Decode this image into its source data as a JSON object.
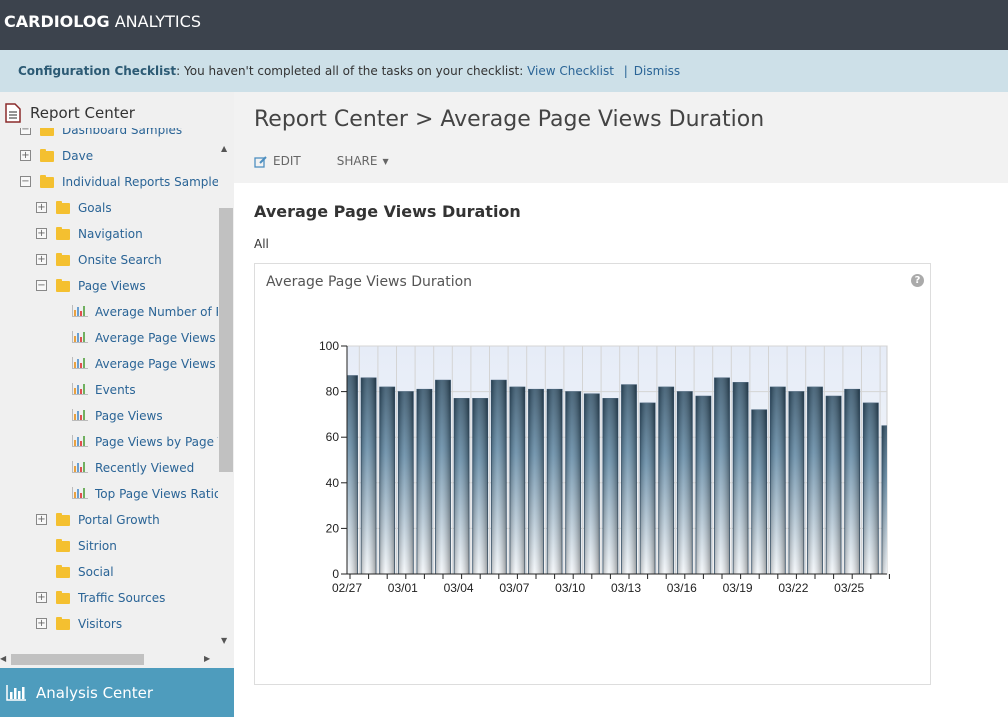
{
  "app": {
    "brand_bold": "CARDIOLOG",
    "brand_rest": " ANALYTICS"
  },
  "banner": {
    "label": "Configuration Checklist",
    "message": ": You haven't completed all of the tasks on your checklist: ",
    "view_link": "View Checklist",
    "separator": "|",
    "dismiss_link": "Dismiss"
  },
  "sidebar": {
    "title": "Report Center",
    "items": [
      {
        "label": "Dashboard Samples",
        "level": 1,
        "type": "folder",
        "expander": "minus"
      },
      {
        "label": "Dave",
        "level": 1,
        "type": "folder",
        "expander": "plus"
      },
      {
        "label": "Individual Reports Samples",
        "level": 1,
        "type": "folder",
        "expander": "minus"
      },
      {
        "label": "Goals",
        "level": 2,
        "type": "folder",
        "expander": "plus"
      },
      {
        "label": "Navigation",
        "level": 2,
        "type": "folder",
        "expander": "plus"
      },
      {
        "label": "Onsite Search",
        "level": 2,
        "type": "folder",
        "expander": "plus"
      },
      {
        "label": "Page Views",
        "level": 2,
        "type": "folder",
        "expander": "minus"
      },
      {
        "label": "Average Number of Page Views",
        "level": 3,
        "type": "report"
      },
      {
        "label": "Average Page Views by",
        "level": 3,
        "type": "report"
      },
      {
        "label": "Average Page Views Duration",
        "level": 3,
        "type": "report"
      },
      {
        "label": "Events",
        "level": 3,
        "type": "report"
      },
      {
        "label": "Page Views",
        "level": 3,
        "type": "report"
      },
      {
        "label": "Page Views by Page Type",
        "level": 3,
        "type": "report"
      },
      {
        "label": "Recently Viewed",
        "level": 3,
        "type": "report"
      },
      {
        "label": "Top Page Views Ratio",
        "level": 3,
        "type": "report"
      },
      {
        "label": "Portal Growth",
        "level": 2,
        "type": "folder",
        "expander": "plus"
      },
      {
        "label": "Sitrion",
        "level": 2,
        "type": "folder"
      },
      {
        "label": "Social",
        "level": 2,
        "type": "folder"
      },
      {
        "label": "Traffic Sources",
        "level": 2,
        "type": "folder",
        "expander": "plus"
      },
      {
        "label": "Visitors",
        "level": 2,
        "type": "folder",
        "expander": "plus"
      }
    ],
    "footer": "Analysis Center"
  },
  "main": {
    "breadcrumb": "Report Center > Average Page Views Duration",
    "edit": "EDIT",
    "share": "SHARE",
    "report_title": "Average Page Views Duration",
    "filter": "All",
    "chart_title": "Average Page Views Duration",
    "help": "?"
  },
  "colors": {
    "header": "#3c434d",
    "banner": "#cde0e8",
    "accent": "#4e9cbd",
    "bar_dark": "#2f4f66",
    "bar_light": "#f4f7fa",
    "plot_bg": "#e9eef8"
  },
  "chart_data": {
    "type": "bar",
    "categories": [
      "02/27",
      "02/28",
      "02/29",
      "03/01",
      "03/02",
      "03/03",
      "03/04",
      "03/05",
      "03/06",
      "03/07",
      "03/08",
      "03/09",
      "03/10",
      "03/11",
      "03/12",
      "03/13",
      "03/14",
      "03/15",
      "03/16",
      "03/17",
      "03/18",
      "03/19",
      "03/20",
      "03/21",
      "03/22",
      "03/23",
      "03/24",
      "03/25",
      "03/26",
      "03/27"
    ],
    "values": [
      87,
      86,
      82,
      80,
      81,
      85,
      77,
      77,
      85,
      82,
      81,
      81,
      80,
      79,
      77,
      83,
      75,
      82,
      80,
      78,
      86,
      84,
      72,
      82,
      80,
      82,
      78,
      81,
      75,
      65
    ],
    "tick_labels": [
      "02/27",
      "03/01",
      "03/04",
      "03/07",
      "03/10",
      "03/13",
      "03/16",
      "03/19",
      "03/22",
      "03/25"
    ],
    "y_ticks": [
      "0",
      "20",
      "40",
      "60",
      "80",
      "100"
    ],
    "ylim": [
      0,
      100
    ],
    "grid": true,
    "legend": "none"
  }
}
